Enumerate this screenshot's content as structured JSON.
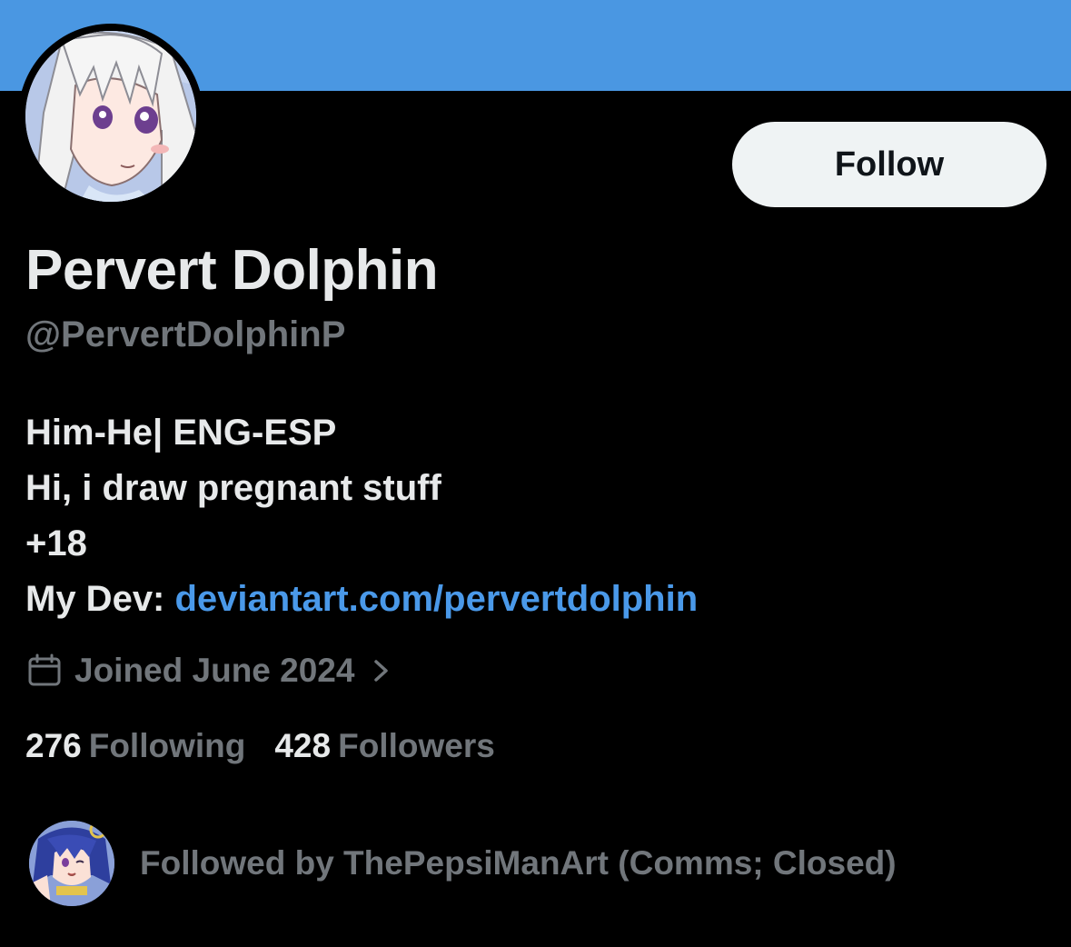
{
  "profile": {
    "display_name": "Pervert Dolphin",
    "handle": "@PervertDolphinP",
    "follow_label": "Follow",
    "bio": {
      "line1": "Him-He| ENG-ESP",
      "line2": "Hi, i draw pregnant stuff",
      "line3": "+18",
      "line4_prefix": "My Dev: ",
      "line4_link": "deviantart.com/pervertdolphin"
    },
    "joined": "Joined June 2024",
    "stats": {
      "following_count": "276",
      "following_label": "Following",
      "followers_count": "428",
      "followers_label": "Followers"
    },
    "followed_by": "Followed by ThePepsiManArt (Comms; Closed)"
  },
  "icons": {
    "calendar": "calendar-icon",
    "chevron": "chevron-right-icon"
  },
  "colors": {
    "banner": "#4a97e2",
    "background": "#000000",
    "primary_text": "#e7e9ea",
    "secondary_text": "#71767b",
    "link": "#4a99e9",
    "follow_button_bg": "#eff3f4"
  }
}
